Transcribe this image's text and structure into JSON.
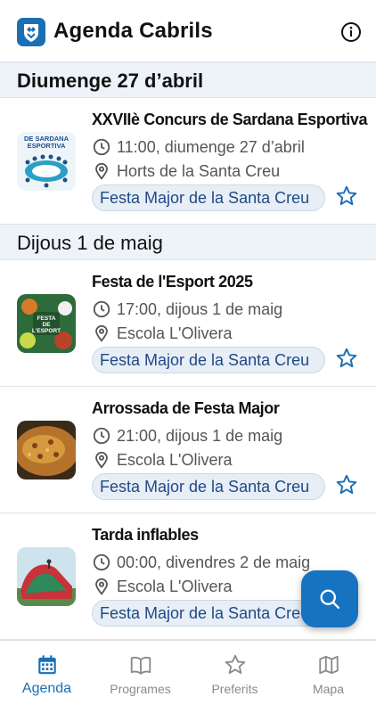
{
  "header": {
    "title": "Agenda Cabrils",
    "logo_icon": "town-shield-icon",
    "info_icon": "info-icon"
  },
  "sections": [
    {
      "date": "Diumenge 27 d’abril",
      "events": [
        {
          "title": "XXVIIè Concurs de Sardana Esportiva",
          "time": "11:00, diumenge 27 d’abril",
          "place": "Horts de la Santa Creu",
          "program": "Festa Major de la Santa Creu",
          "thumb_text": [
            "DE SARDANA",
            "ESPORTIVA"
          ]
        }
      ]
    },
    {
      "date": "Dijous 1 de maig",
      "events": [
        {
          "title": "Festa de l'Esport 2025",
          "time": "17:00, dijous 1 de maig",
          "place": "Escola L'Olivera",
          "program": "Festa Major de la Santa Creu",
          "thumb_text": [
            "FESTA",
            "DE",
            "L'ESPORT"
          ]
        },
        {
          "title": "Arrossada de Festa Major",
          "time": "21:00, dijous 1 de maig",
          "place": "Escola L'Olivera",
          "program": "Festa Major de la Santa Creu"
        },
        {
          "title": "Tarda inflables",
          "time": "00:00, divendres 2 de maig",
          "place": "Escola L'Olivera",
          "program": "Festa Major de la Santa Creu"
        }
      ]
    }
  ],
  "fab": {
    "icon": "search-icon"
  },
  "nav": [
    {
      "label": "Agenda",
      "icon": "calendar-icon",
      "active": true
    },
    {
      "label": "Programes",
      "icon": "book-icon",
      "active": false
    },
    {
      "label": "Preferits",
      "icon": "star-icon",
      "active": false
    },
    {
      "label": "Mapa",
      "icon": "map-icon",
      "active": false
    }
  ],
  "colors": {
    "accent": "#1a6fb5",
    "fab": "#1573c2",
    "chip_bg": "#e8eef6",
    "chip_text": "#1e4a86",
    "date_header_bg": "#eef3f9"
  }
}
